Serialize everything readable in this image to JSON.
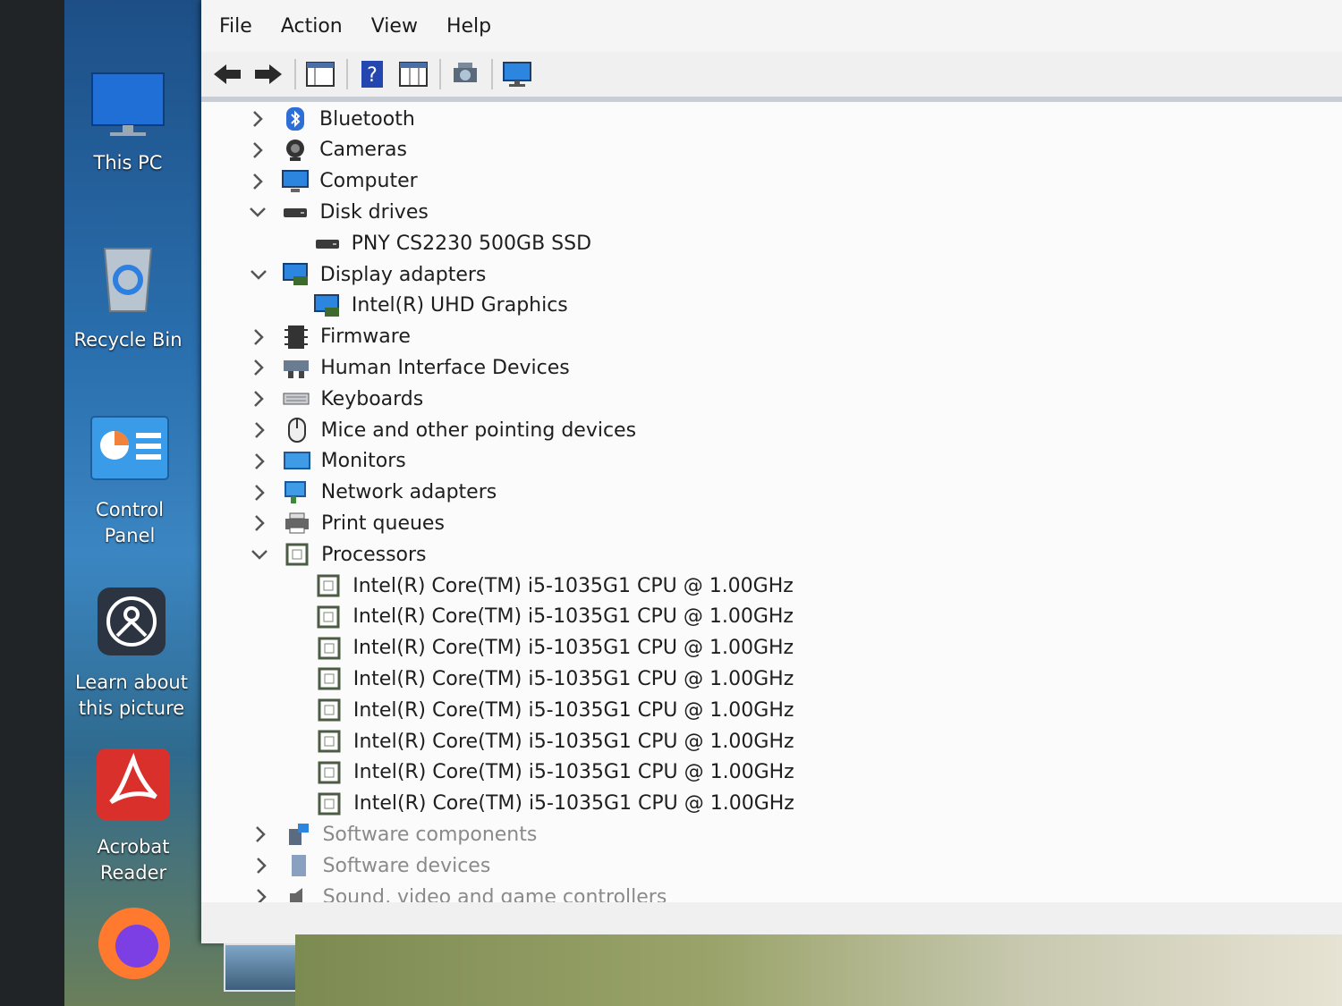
{
  "desktop": {
    "icons": [
      {
        "label": "This PC",
        "icon": "monitor-icon"
      },
      {
        "label": "Recycle Bin",
        "icon": "recycle-bin-icon"
      },
      {
        "label": "Control\nPanel",
        "icon": "control-panel-icon"
      },
      {
        "label": "Learn about\nthis picture",
        "icon": "learn-picture-icon"
      },
      {
        "label": "Acrobat\nReader",
        "icon": "acrobat-reader-icon"
      },
      {
        "label": "",
        "icon": "firefox-icon"
      }
    ]
  },
  "window": {
    "menu": [
      "File",
      "Action",
      "View",
      "Help"
    ],
    "toolbar": [
      "back-icon",
      "forward-icon",
      "properties-grid-icon",
      "help-icon",
      "details-grid-icon",
      "scan-hardware-icon",
      "monitor-icon"
    ],
    "tree": [
      {
        "label": "Bluetooth",
        "state": "collapsed",
        "level": 0,
        "icon": "bluetooth-icon"
      },
      {
        "label": "Cameras",
        "state": "collapsed",
        "level": 0,
        "icon": "camera-icon"
      },
      {
        "label": "Computer",
        "state": "collapsed",
        "level": 0,
        "icon": "computer-icon"
      },
      {
        "label": "Disk drives",
        "state": "expanded",
        "level": 0,
        "icon": "disk-drive-icon"
      },
      {
        "label": "PNY CS2230 500GB SSD",
        "state": "leaf",
        "level": 1,
        "icon": "disk-drive-icon"
      },
      {
        "label": "Display adapters",
        "state": "expanded",
        "level": 0,
        "icon": "display-adapter-icon"
      },
      {
        "label": "Intel(R) UHD Graphics",
        "state": "leaf",
        "level": 1,
        "icon": "display-adapter-icon"
      },
      {
        "label": "Firmware",
        "state": "collapsed",
        "level": 0,
        "icon": "firmware-icon"
      },
      {
        "label": "Human Interface Devices",
        "state": "collapsed",
        "level": 0,
        "icon": "hid-icon"
      },
      {
        "label": "Keyboards",
        "state": "collapsed",
        "level": 0,
        "icon": "keyboard-icon"
      },
      {
        "label": "Mice and other pointing devices",
        "state": "collapsed",
        "level": 0,
        "icon": "mouse-icon"
      },
      {
        "label": "Monitors",
        "state": "collapsed",
        "level": 0,
        "icon": "monitor-icon"
      },
      {
        "label": "Network adapters",
        "state": "collapsed",
        "level": 0,
        "icon": "network-icon"
      },
      {
        "label": "Print queues",
        "state": "collapsed",
        "level": 0,
        "icon": "printer-icon"
      },
      {
        "label": "Processors",
        "state": "expanded",
        "level": 0,
        "icon": "processor-icon"
      },
      {
        "label": "Intel(R) Core(TM) i5-1035G1 CPU @ 1.00GHz",
        "state": "leaf",
        "level": 1,
        "icon": "processor-icon"
      },
      {
        "label": "Intel(R) Core(TM) i5-1035G1 CPU @ 1.00GHz",
        "state": "leaf",
        "level": 1,
        "icon": "processor-icon"
      },
      {
        "label": "Intel(R) Core(TM) i5-1035G1 CPU @ 1.00GHz",
        "state": "leaf",
        "level": 1,
        "icon": "processor-icon"
      },
      {
        "label": "Intel(R) Core(TM) i5-1035G1 CPU @ 1.00GHz",
        "state": "leaf",
        "level": 1,
        "icon": "processor-icon"
      },
      {
        "label": "Intel(R) Core(TM) i5-1035G1 CPU @ 1.00GHz",
        "state": "leaf",
        "level": 1,
        "icon": "processor-icon"
      },
      {
        "label": "Intel(R) Core(TM) i5-1035G1 CPU @ 1.00GHz",
        "state": "leaf",
        "level": 1,
        "icon": "processor-icon"
      },
      {
        "label": "Intel(R) Core(TM) i5-1035G1 CPU @ 1.00GHz",
        "state": "leaf",
        "level": 1,
        "icon": "processor-icon"
      },
      {
        "label": "Intel(R) Core(TM) i5-1035G1 CPU @ 1.00GHz",
        "state": "leaf",
        "level": 1,
        "icon": "processor-icon"
      },
      {
        "label": "Software components",
        "state": "collapsed",
        "level": 0,
        "icon": "software-components-icon"
      },
      {
        "label": "Software devices",
        "state": "collapsed",
        "level": 0,
        "icon": "software-devices-icon"
      },
      {
        "label": "Sound, video and game controllers",
        "state": "collapsed",
        "level": 0,
        "icon": "sound-icon"
      }
    ]
  }
}
